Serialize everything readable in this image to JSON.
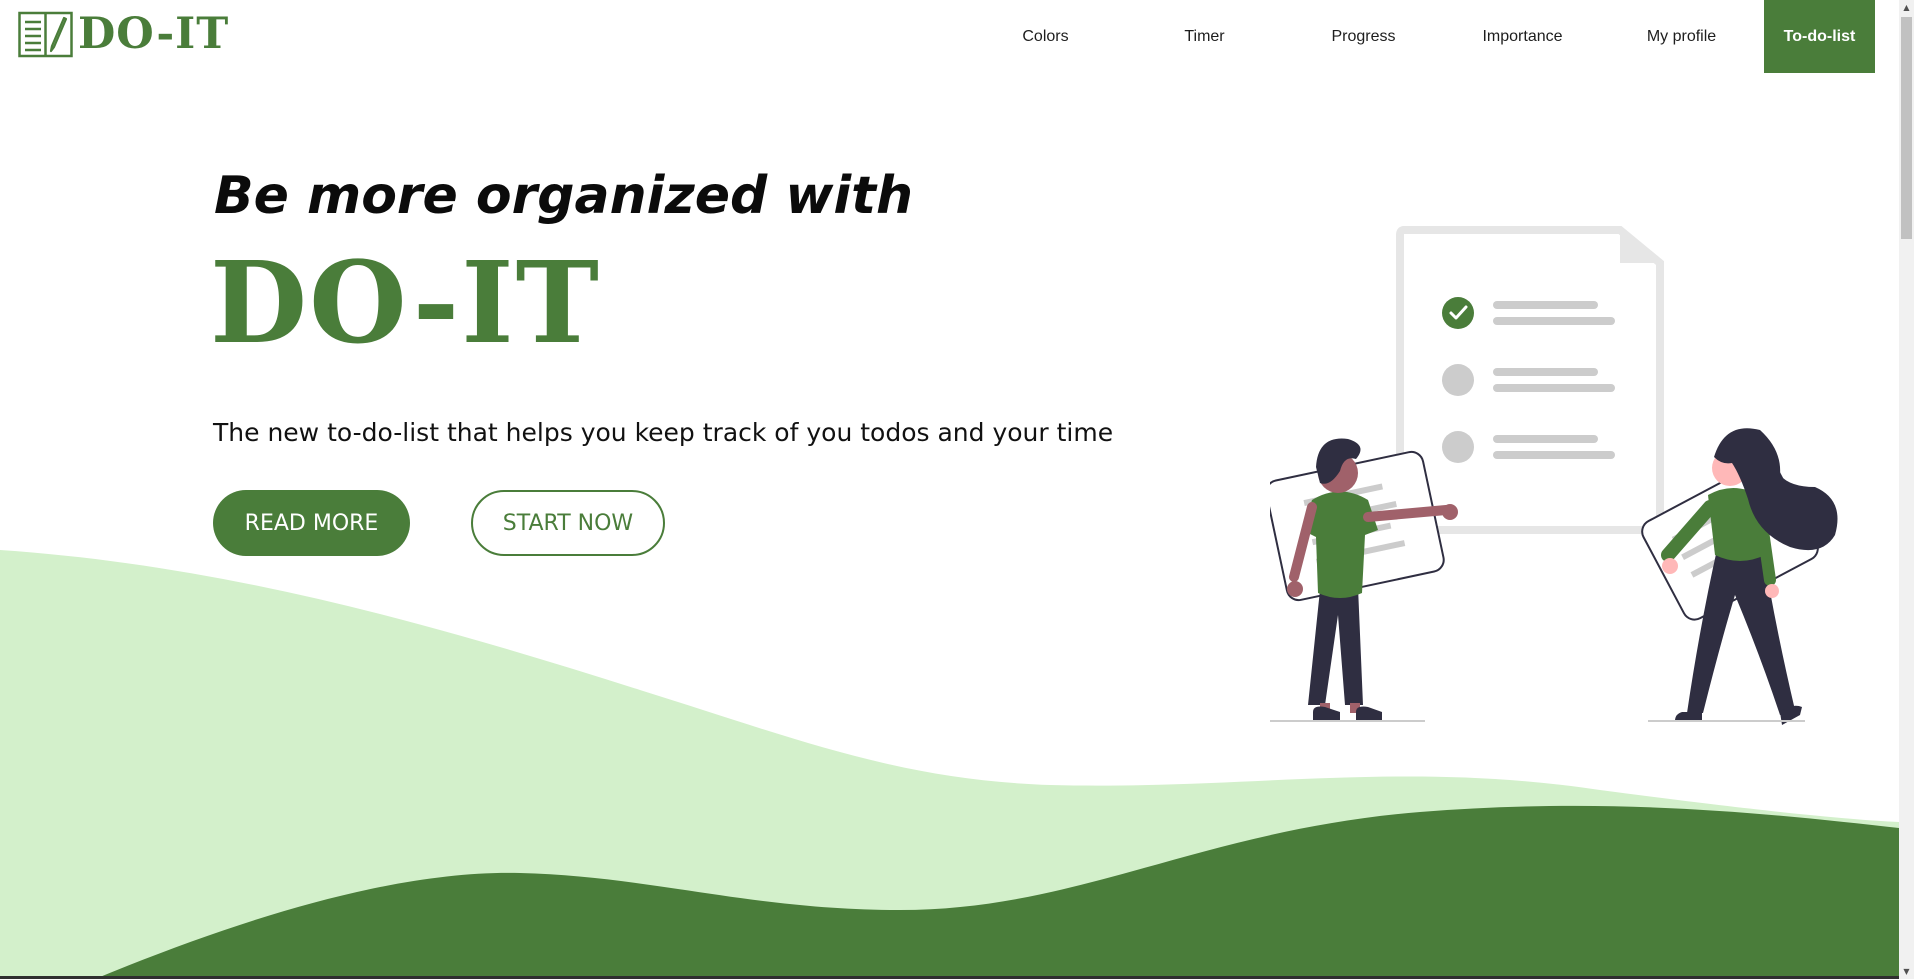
{
  "header": {
    "logo_text": "DO-IT",
    "logo_icon": "notebook-pencil-icon",
    "nav": [
      {
        "label": "Colors",
        "active": false
      },
      {
        "label": "Timer",
        "active": false
      },
      {
        "label": "Progress",
        "active": false
      },
      {
        "label": "Importance",
        "active": false
      },
      {
        "label": "My profile",
        "active": false
      },
      {
        "label": "To-do-list",
        "active": true
      }
    ]
  },
  "hero": {
    "tagline": "Be more organized with",
    "brand": "DO-IT",
    "description": "The new to-do-list that helps you keep track of you todos and your time",
    "primary_button": "READ MORE",
    "secondary_button": "START NOW",
    "illustration": "people-checklist-illustration"
  },
  "colors": {
    "brand_green": "#4a7d3a",
    "light_green": "#d3f0cb",
    "dark_figure": "#2f2e41"
  }
}
